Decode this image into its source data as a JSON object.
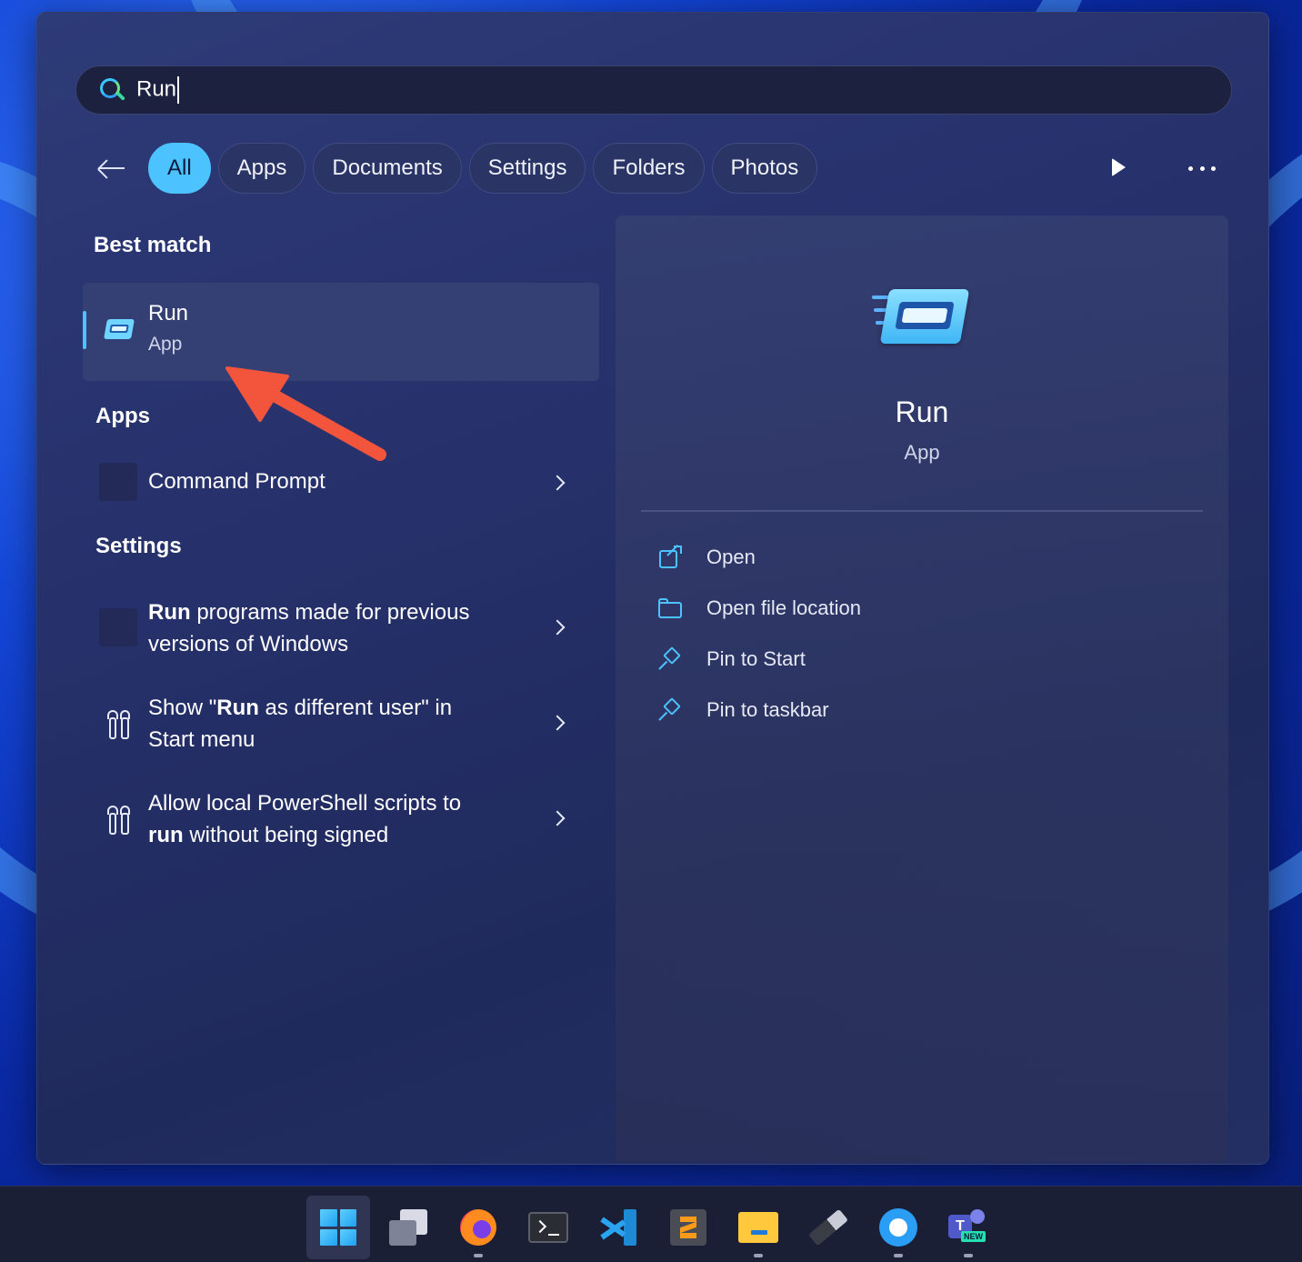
{
  "search": {
    "query": "Run"
  },
  "filters": {
    "back_label": "",
    "chips": [
      "All",
      "Apps",
      "Documents",
      "Settings",
      "Folders",
      "Photos"
    ],
    "active": "All"
  },
  "left": {
    "best_match_title": "Best match",
    "best_match": {
      "title": "Run",
      "subtitle": "App"
    },
    "apps_title": "Apps",
    "apps": [
      {
        "title": "Command Prompt"
      }
    ],
    "settings_title": "Settings",
    "settings": [
      {
        "line1_bold": "Run",
        "line1_rest": " programs made for previous",
        "line2": "versions of Windows"
      },
      {
        "line1_pre": "Show \"",
        "line1_bold": "Run",
        "line1_rest": " as different user\" in",
        "line2": "Start menu"
      },
      {
        "line1": "Allow local PowerShell scripts to",
        "line2_bold": "run",
        "line2_rest": " without being signed"
      }
    ]
  },
  "preview": {
    "title": "Run",
    "subtitle": "App",
    "actions": [
      "Open",
      "Open file location",
      "Pin to Start",
      "Pin to taskbar"
    ]
  },
  "taskbar": {
    "items": [
      "windows-start-icon",
      "task-view-icon",
      "firefox-icon",
      "terminal-icon",
      "vscode-icon",
      "sublime-text-icon",
      "file-explorer-icon",
      "usb-drive-icon",
      "snipping-tool-icon",
      "teams-icon"
    ],
    "teams_badge": "NEW"
  },
  "colors": {
    "accent": "#4cc2ff",
    "annotation_arrow": "#f2553c"
  }
}
